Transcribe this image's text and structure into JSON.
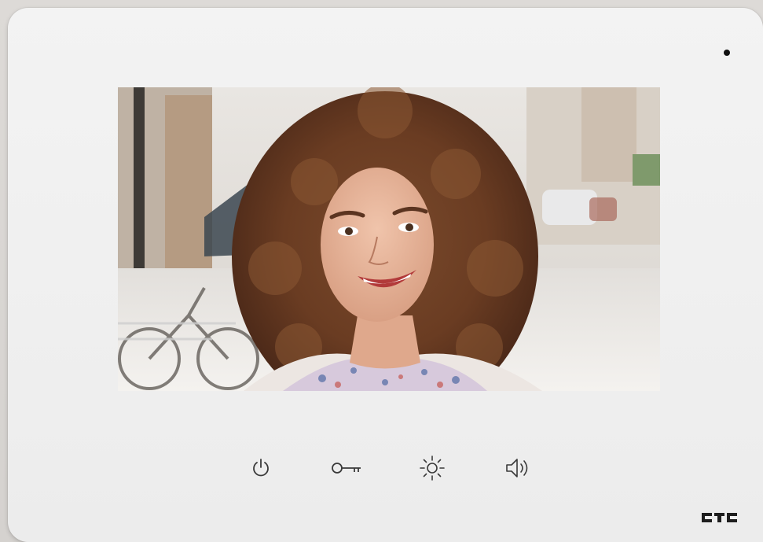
{
  "device": {
    "brand_logo_text": "CTC",
    "screen": {
      "content": "video-feed"
    },
    "buttons": [
      {
        "id": "power",
        "icon": "power-icon"
      },
      {
        "id": "unlock",
        "icon": "key-icon"
      },
      {
        "id": "brightness",
        "icon": "brightness-icon"
      },
      {
        "id": "volume",
        "icon": "speaker-icon"
      }
    ]
  },
  "colors": {
    "body": "#f0f0f0",
    "icon": "#3a3a3a",
    "background": "#d9d6d3"
  }
}
